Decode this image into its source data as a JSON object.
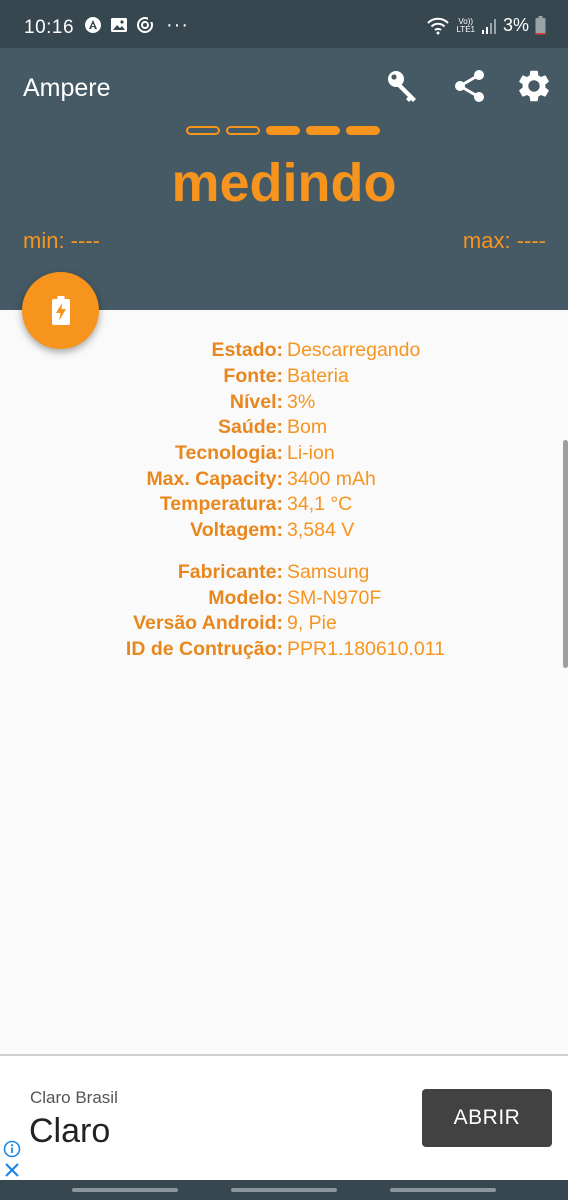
{
  "status_bar": {
    "time": "10:16",
    "battery_percent": "3%",
    "network": "LTE1",
    "volte": "Vo))",
    "icons_left": [
      "accessibility-icon",
      "image-icon",
      "sync-icon",
      "more-dots-icon"
    ],
    "icons_right": [
      "wifi-icon",
      "signal-icon",
      "battery-icon"
    ]
  },
  "app_bar": {
    "title": "Ampere",
    "actions": [
      "key-icon",
      "share-icon",
      "settings-icon"
    ]
  },
  "measure": {
    "status_word": "medindo",
    "min_label": "min: ----",
    "max_label": "max: ----",
    "progress_dots": {
      "total": 5,
      "filled": 3
    }
  },
  "fab": {
    "icon": "battery-charging-icon"
  },
  "info": {
    "battery": [
      {
        "label": "Estado:",
        "value": "Descarregando"
      },
      {
        "label": "Fonte:",
        "value": "Bateria"
      },
      {
        "label": "Nível:",
        "value": "3%"
      },
      {
        "label": "Saúde:",
        "value": "Bom"
      },
      {
        "label": "Tecnologia:",
        "value": "Li-ion"
      },
      {
        "label": "Max. Capacity:",
        "value": "3400 mAh"
      },
      {
        "label": "Temperatura:",
        "value": "34,1 °C"
      },
      {
        "label": "Voltagem:",
        "value": "3,584 V"
      }
    ],
    "device": [
      {
        "label": "Fabricante:",
        "value": "Samsung"
      },
      {
        "label": "Modelo:",
        "value": "SM-N970F"
      },
      {
        "label": "Versão Android:",
        "value": "9, Pie"
      },
      {
        "label": "ID de Contrução:",
        "value": "PPR1.180610.011"
      }
    ]
  },
  "ad": {
    "advertiser": "Claro Brasil",
    "headline": "Claro",
    "cta": "ABRIR"
  },
  "colors": {
    "accent": "#f7941d",
    "header": "#455a64",
    "status_bar": "#37474f"
  }
}
